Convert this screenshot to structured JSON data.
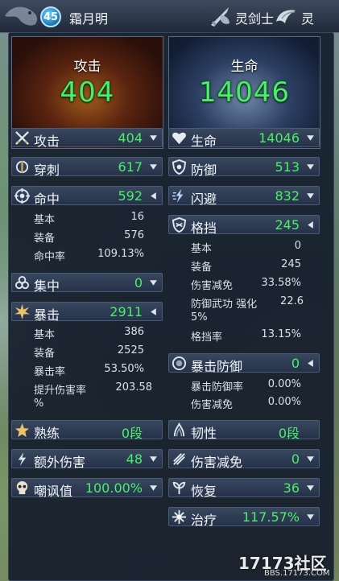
{
  "header": {
    "level": "45",
    "player_name": "霜月明",
    "class_name": "灵剑士",
    "race_name": "灵",
    "class_icon": "sword-shield-icon",
    "race_icon": "race-icon"
  },
  "hero": {
    "attack": {
      "label": "攻击",
      "value": "404"
    },
    "hp": {
      "label": "生命",
      "value": "14046"
    }
  },
  "left": {
    "attack": {
      "icon": "crossed-swords-icon",
      "label": "攻击",
      "value": "404"
    },
    "pierce": {
      "icon": "pierce-icon",
      "label": "穿刺",
      "value": "617"
    },
    "accuracy": {
      "icon": "target-icon",
      "label": "命中",
      "value": "592",
      "details": [
        {
          "label": "基本",
          "value": "16"
        },
        {
          "label": "装备",
          "value": "576"
        },
        {
          "label": "命中率",
          "value": "109.13%"
        }
      ]
    },
    "focus": {
      "icon": "focus-icon",
      "label": "集中",
      "value": "0"
    },
    "critical": {
      "icon": "burst-icon",
      "label": "暴击",
      "value": "2911",
      "details": [
        {
          "label": "基本",
          "value": "386"
        },
        {
          "label": "装备",
          "value": "2525"
        },
        {
          "label": "暴击率",
          "value": "53.50%"
        },
        {
          "label": "提升伤害率",
          "value": "203.58"
        },
        {
          "label": "%",
          "value": ""
        }
      ]
    },
    "mastery": {
      "icon": "mastery-icon",
      "label": "熟练",
      "value": "0段"
    },
    "extra_damage": {
      "icon": "lightning-icon",
      "label": "额外伤害",
      "value": "48"
    },
    "taunt": {
      "icon": "skull-icon",
      "label": "嘲讽值",
      "value": "100.00%"
    }
  },
  "right": {
    "hp": {
      "icon": "heart-icon",
      "label": "生命",
      "value": "14046"
    },
    "defense": {
      "icon": "shield-icon",
      "label": "防御",
      "value": "513"
    },
    "evasion": {
      "icon": "evasion-icon",
      "label": "闪避",
      "value": "832"
    },
    "block": {
      "icon": "block-shield-icon",
      "label": "格挡",
      "value": "245",
      "details": [
        {
          "label": "基本",
          "value": "0"
        },
        {
          "label": "装备",
          "value": "245"
        },
        {
          "label": "伤害减免",
          "value": "33.58%"
        },
        {
          "label": "防御武功 强化",
          "value": "22.6"
        },
        {
          "label": "5%",
          "value": ""
        },
        {
          "label": "格挡率",
          "value": "13.15%"
        }
      ]
    },
    "crit_defense": {
      "icon": "crit-defense-icon",
      "label": "暴击防御",
      "value": "0",
      "details": [
        {
          "label": "暴击防御率",
          "value": "0.00%"
        },
        {
          "label": "伤害减免",
          "value": "0.00%"
        }
      ]
    },
    "toughness": {
      "icon": "toughness-icon",
      "label": "韧性",
      "value": "0段"
    },
    "damage_reduction": {
      "icon": "damage-reduction-icon",
      "label": "伤害减免",
      "value": "0"
    },
    "recovery": {
      "icon": "recovery-icon",
      "label": "恢复",
      "value": "36"
    },
    "healing": {
      "icon": "healing-icon",
      "label": "治疗",
      "value": "117.57%"
    }
  },
  "watermark": {
    "logo": "17173社区",
    "url": "BBS.17173.COM"
  }
}
